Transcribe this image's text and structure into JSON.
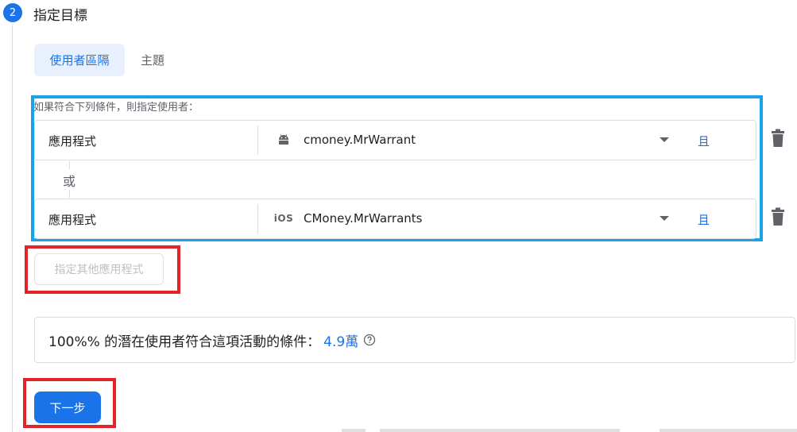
{
  "step": {
    "number": "2",
    "title": "指定目標"
  },
  "tabs": [
    {
      "label": "使用者區隔",
      "active": true
    },
    {
      "label": "主題",
      "active": false
    }
  ],
  "conditions": {
    "intro": "如果符合下列條件，則指定使用者：",
    "or_label": "或",
    "rows": [
      {
        "label": "應用程式",
        "platform_icon": "android-icon",
        "value": "cmoney.MrWarrant",
        "and_label": "且"
      },
      {
        "label": "應用程式",
        "platform_icon": "ios-icon",
        "platform_text": "iOS",
        "value": "CMoney.MrWarrants",
        "and_label": "且"
      }
    ]
  },
  "add_app_label": "指定其他應用程式",
  "reach": {
    "text": "100%% 的潛在使用者符合這項活動的條件：",
    "count": "4.9萬"
  },
  "next_label": "下一步",
  "colors": {
    "accent": "#1a73e8",
    "highlight_blue": "#1aa3e8",
    "highlight_red": "#e2232a"
  }
}
